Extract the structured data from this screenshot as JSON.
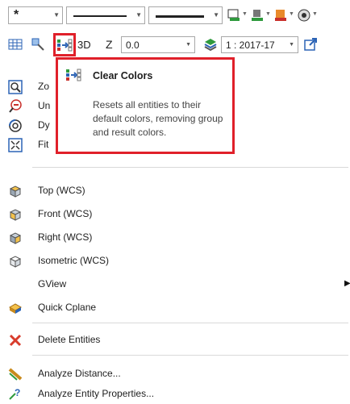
{
  "toolbar": {
    "linestyle_value": "*",
    "z_label": "Z",
    "z_value": "0.0",
    "view_3d_label": "3D",
    "level_value": "1 : 2017-17"
  },
  "tooltip": {
    "title": "Clear Colors",
    "description": "Resets all entities to their default colors, removing group and result colors."
  },
  "menu": {
    "items": [
      {
        "label": "Zoom Window",
        "visible_text": "Zo"
      },
      {
        "label": "Un",
        "visible_text": "Un"
      },
      {
        "label": "Dy",
        "visible_text": "Dy"
      },
      {
        "label": "Fit"
      },
      {
        "label": "Top (WCS)"
      },
      {
        "label": "Front (WCS)"
      },
      {
        "label": "Right (WCS)"
      },
      {
        "label": "Isometric (WCS)"
      },
      {
        "label": "GView"
      },
      {
        "label": "Quick Cplane"
      },
      {
        "label": "Delete Entities"
      },
      {
        "label": "Analyze Distance..."
      },
      {
        "label": "Analyze Entity Properties..."
      }
    ]
  },
  "colors": {
    "highlight": "#e0202a",
    "delete_icon": "#d83b2b",
    "icon_blue": "#2b63b5"
  }
}
